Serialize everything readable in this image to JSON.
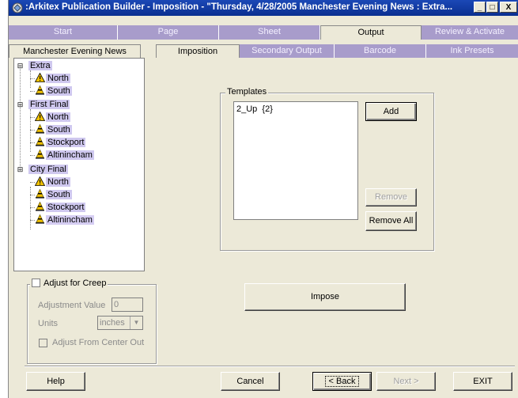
{
  "window": {
    "title": ":Arkitex Publication Builder - Imposition - \"Thursday, 4/28/2005 Manchester Evening News : Extra...",
    "minimize": "_",
    "maximize": "□",
    "close": "X"
  },
  "main_tabs": [
    {
      "label": "Start",
      "active": false
    },
    {
      "label": "Page",
      "active": false
    },
    {
      "label": "Sheet",
      "active": false
    },
    {
      "label": "Output",
      "active": true
    },
    {
      "label": "Review & Activate",
      "active": false
    }
  ],
  "sub_tabs": [
    {
      "label": "Manchester Evening News",
      "active": false
    },
    {
      "label": "Imposition",
      "active": true
    },
    {
      "label": "Secondary Output",
      "active": false
    },
    {
      "label": "Barcode",
      "active": false
    },
    {
      "label": "Ink Presets",
      "active": false
    }
  ],
  "tree": {
    "editions": [
      {
        "label": "Extra",
        "zones": [
          {
            "label": "North",
            "icon": "warning-icon"
          },
          {
            "label": "South",
            "icon": "cone-icon"
          }
        ]
      },
      {
        "label": "First Final",
        "zones": [
          {
            "label": "North",
            "icon": "warning-icon"
          },
          {
            "label": "South",
            "icon": "cone-icon"
          },
          {
            "label": "Stockport",
            "icon": "cone-icon"
          },
          {
            "label": "Altinincham",
            "icon": "cone-icon"
          }
        ]
      },
      {
        "label": "City Final",
        "zones": [
          {
            "label": "North",
            "icon": "warning-icon"
          },
          {
            "label": "South",
            "icon": "cone-icon"
          },
          {
            "label": "Stockport",
            "icon": "cone-icon"
          },
          {
            "label": "Altinincham",
            "icon": "cone-icon"
          }
        ]
      }
    ]
  },
  "templates": {
    "group_label": "Templates",
    "items": [
      "2_Up  {2}"
    ],
    "add_label": "Add",
    "remove_label": "Remove",
    "remove_all_label": "Remove All"
  },
  "impose_label": "Impose",
  "creep": {
    "checkbox_label": "Adjust for Creep",
    "adjustment_label": "Adjustment Value",
    "adjustment_value": "0",
    "units_label": "Units",
    "units_value": "inches",
    "center_out_label": "Adjust From Center Out"
  },
  "footer": {
    "help": "Help",
    "cancel": "Cancel",
    "back": "< Back",
    "next": "Next >",
    "exit": "EXIT"
  },
  "colors": {
    "titlebar": "#0a2f90",
    "tab_inactive": "#a89ccb",
    "tree_highlight": "#cfc8ef",
    "warning": "#f2c200"
  }
}
